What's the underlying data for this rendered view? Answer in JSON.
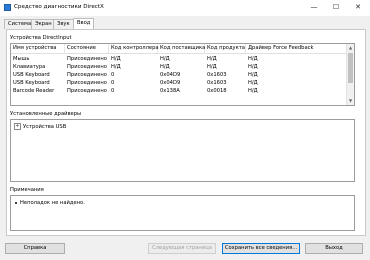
{
  "window": {
    "title": "Средство диагностики DirectX",
    "minimize_glyph": "—",
    "maximize_glyph": "☐",
    "close_glyph": "✕",
    "icon": "directx-app-icon"
  },
  "tabs": [
    {
      "label": "Система"
    },
    {
      "label": "Экран"
    },
    {
      "label": "Звук"
    },
    {
      "label": "Ввод",
      "active": true
    }
  ],
  "directinput": {
    "title": "Устройства DirectInput",
    "columns": [
      "Имя устройства",
      "Состояние",
      "Код контроллера",
      "Код поставщика",
      "Код продукта",
      "Драйвер Force Feedback"
    ],
    "rows": [
      [
        "Мышь",
        "Присоединено",
        "Н/Д",
        "Н/Д",
        "Н/Д",
        "Н/Д"
      ],
      [
        "Клавиатура",
        "Присоединено",
        "Н/Д",
        "Н/Д",
        "Н/Д",
        "Н/Д"
      ],
      [
        "USB Keyboard",
        "Присоединено",
        "0",
        "0x04D9",
        "0x1603",
        "Н/Д"
      ],
      [
        "USB Keyboard",
        "Присоединено",
        "0",
        "0x04D9",
        "0x1603",
        "Н/Д"
      ],
      [
        "Barcode Reader",
        "Присоединено",
        "0",
        "0x138A",
        "0x0018",
        "Н/Д"
      ]
    ]
  },
  "drivers": {
    "title": "Установленные драйверы",
    "tree": [
      {
        "label": "Устройства USB",
        "expander": "+"
      }
    ]
  },
  "notes": {
    "title": "Примечания",
    "items": [
      "Неполадок не найдено."
    ]
  },
  "buttons": {
    "help": "Справка",
    "next_page": "Следующая страница",
    "save_all": "Сохранить все сведения...",
    "exit": "Выход"
  },
  "scroll_arrows": {
    "up": "▲",
    "down": "▼"
  }
}
